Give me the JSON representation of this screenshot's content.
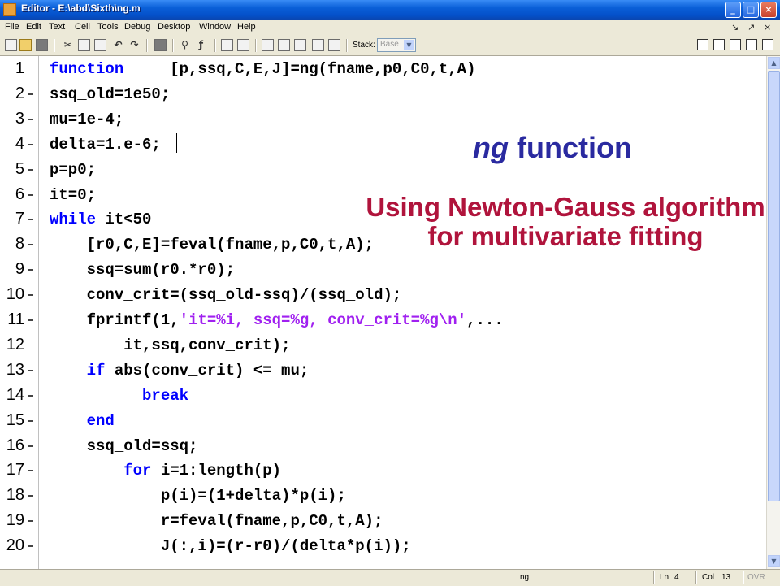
{
  "window": {
    "title": "Editor - E:\\abd\\Sixth\\ng.m",
    "controls": [
      "minimize",
      "maximize",
      "close"
    ]
  },
  "menu": {
    "items": [
      "File",
      "Edit",
      "Text",
      "Cell",
      "Tools",
      "Debug",
      "Desktop",
      "Window",
      "Help"
    ],
    "right_glyphs": [
      "↘",
      "↗",
      "×"
    ]
  },
  "toolbar": {
    "stack_label": "Stack:",
    "stack_value": "Base"
  },
  "editor": {
    "lines": [
      {
        "num": "1",
        "marker": false,
        "tokens": [
          {
            "t": "function",
            "c": "kw"
          },
          {
            "t": "     [p,ssq,C,E,J]=ng(fname,p0,C0,t,A)",
            "c": ""
          }
        ]
      },
      {
        "num": "2",
        "marker": true,
        "tokens": [
          {
            "t": "ssq_old=1e50;",
            "c": ""
          }
        ]
      },
      {
        "num": "3",
        "marker": true,
        "tokens": [
          {
            "t": "mu=1e-4;",
            "c": ""
          }
        ]
      },
      {
        "num": "4",
        "marker": true,
        "tokens": [
          {
            "t": "delta=1.e-6;",
            "c": ""
          }
        ]
      },
      {
        "num": "5",
        "marker": true,
        "tokens": [
          {
            "t": "p=p0;",
            "c": ""
          }
        ]
      },
      {
        "num": "6",
        "marker": true,
        "tokens": [
          {
            "t": "it=0;",
            "c": ""
          }
        ]
      },
      {
        "num": "7",
        "marker": true,
        "tokens": [
          {
            "t": "while",
            "c": "kw"
          },
          {
            "t": " it<50",
            "c": ""
          }
        ]
      },
      {
        "num": "8",
        "marker": true,
        "tokens": [
          {
            "t": "    [r0,C,E]=feval(fname,p,C0,t,A);",
            "c": ""
          }
        ]
      },
      {
        "num": "9",
        "marker": true,
        "tokens": [
          {
            "t": "    ssq=sum(r0.*r0);",
            "c": ""
          }
        ]
      },
      {
        "num": "10",
        "marker": true,
        "tokens": [
          {
            "t": "    conv_crit=(ssq_old-ssq)/(ssq_old);",
            "c": ""
          }
        ]
      },
      {
        "num": "11",
        "marker": true,
        "tokens": [
          {
            "t": "    fprintf(1,",
            "c": ""
          },
          {
            "t": "'it=%i, ssq=%g, conv_crit=%g\\n'",
            "c": "str"
          },
          {
            "t": ",...",
            "c": ""
          }
        ]
      },
      {
        "num": "12",
        "marker": false,
        "tokens": [
          {
            "t": "        it,ssq,conv_crit);",
            "c": ""
          }
        ]
      },
      {
        "num": "13",
        "marker": true,
        "tokens": [
          {
            "t": "    ",
            "c": ""
          },
          {
            "t": "if",
            "c": "kw"
          },
          {
            "t": " abs(conv_crit) <= mu;",
            "c": ""
          }
        ]
      },
      {
        "num": "14",
        "marker": true,
        "tokens": [
          {
            "t": "          ",
            "c": ""
          },
          {
            "t": "break",
            "c": "kw"
          }
        ]
      },
      {
        "num": "15",
        "marker": true,
        "tokens": [
          {
            "t": "    ",
            "c": ""
          },
          {
            "t": "end",
            "c": "kw"
          }
        ]
      },
      {
        "num": "16",
        "marker": true,
        "tokens": [
          {
            "t": "    ssq_old=ssq;",
            "c": ""
          }
        ]
      },
      {
        "num": "17",
        "marker": true,
        "tokens": [
          {
            "t": "        ",
            "c": ""
          },
          {
            "t": "for",
            "c": "kw"
          },
          {
            "t": " i=1:length(p)",
            "c": ""
          }
        ]
      },
      {
        "num": "18",
        "marker": true,
        "tokens": [
          {
            "t": "            p(i)=(1+delta)*p(i);",
            "c": ""
          }
        ]
      },
      {
        "num": "19",
        "marker": true,
        "tokens": [
          {
            "t": "            r=feval(fname,p,C0,t,A);",
            "c": ""
          }
        ]
      },
      {
        "num": "20",
        "marker": true,
        "tokens": [
          {
            "t": "            J(:,i)=(r-r0)/(delta*p(i));",
            "c": ""
          }
        ]
      }
    ]
  },
  "annotations": {
    "title_italic": "ng",
    "title_rest": " function",
    "subtitle": "Using Newton-Gauss algorithm for multivariate fitting",
    "title_color": "#2a2aa0",
    "subtitle_color": "#b0143c"
  },
  "status": {
    "file": "ng",
    "ln_label": "Ln",
    "ln_value": "4",
    "col_label": "Col",
    "col_value": "13",
    "ovr": "OVR"
  },
  "colors": {
    "keyword": "#0000ff",
    "string": "#a020f0",
    "titlebar": "#0a5fd8"
  }
}
